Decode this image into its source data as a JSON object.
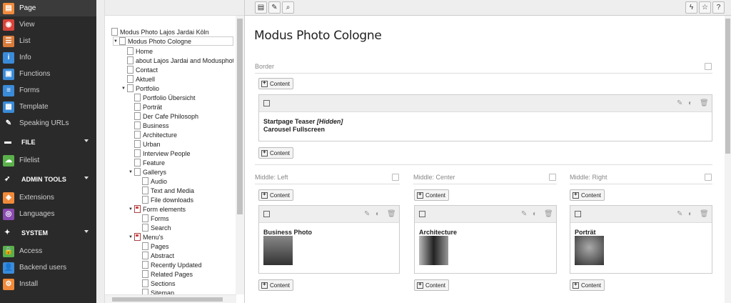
{
  "module_menu": {
    "items": [
      {
        "label": "Page",
        "color": "#f18a3a",
        "glyph": "▤",
        "active": true,
        "icon": "page-icon"
      },
      {
        "label": "View",
        "color": "#d9433a",
        "glyph": "◉",
        "icon": "view-icon"
      },
      {
        "label": "List",
        "color": "#d97b3a",
        "glyph": "☰",
        "icon": "list-icon"
      },
      {
        "label": "Info",
        "color": "#3a8bd9",
        "glyph": "i",
        "icon": "info-icon"
      },
      {
        "label": "Functions",
        "color": "#3a8bd9",
        "glyph": "▣",
        "icon": "functions-icon"
      },
      {
        "label": "Forms",
        "color": "#3a8bd9",
        "glyph": "≡",
        "icon": "forms-icon"
      },
      {
        "label": "Template",
        "color": "#3a8bd9",
        "glyph": "▦",
        "icon": "template-icon"
      },
      {
        "label": "Speaking URLs",
        "color": "#2a2a2a",
        "glyph": "✎",
        "icon": "speaking-urls-icon"
      }
    ],
    "file_section": "FILE",
    "file_items": [
      {
        "label": "Filelist",
        "color": "#5ab04a",
        "glyph": "☁",
        "icon": "filelist-icon"
      }
    ],
    "admin_section": "ADMIN TOOLS",
    "admin_items": [
      {
        "label": "Extensions",
        "color": "#f18a3a",
        "glyph": "◈",
        "icon": "extensions-icon"
      },
      {
        "label": "Languages",
        "color": "#8a4ab0",
        "glyph": "◎",
        "icon": "languages-icon"
      }
    ],
    "system_section": "SYSTEM",
    "system_items": [
      {
        "label": "Access",
        "color": "#5ab04a",
        "glyph": "🔒",
        "icon": "access-icon"
      },
      {
        "label": "Backend users",
        "color": "#3a8bd9",
        "glyph": "👤",
        "icon": "backend-users-icon"
      },
      {
        "label": "Install",
        "color": "#f18a3a",
        "glyph": "⚙",
        "icon": "install-icon"
      }
    ]
  },
  "tree": {
    "root": "Modus Photo Lajos Jardai Köln",
    "site": "Modus Photo Cologne",
    "nodes": [
      "Home",
      "about Lajos Jardai and Modusphoto",
      "Contact",
      "Aktuell",
      "Portfolio",
      "Portfolio Übersicht",
      "Porträt",
      "Der Cafe Philosoph",
      "Business",
      "Architecture",
      "Urban",
      "Interview People",
      "Feature",
      "Gallerys",
      "Audio",
      "Text and Media",
      "File downloads",
      "Form elements",
      "Forms",
      "Search",
      "Menu's",
      "Pages",
      "Abstract",
      "Recently Updated",
      "Related Pages",
      "Sections",
      "Sitemap"
    ]
  },
  "content": {
    "page_title": "Modus Photo Cologne",
    "border_label": "Border",
    "btn_content": "Content",
    "teaser_title": "Startpage Teaser",
    "teaser_hidden": "[Hidden]",
    "teaser_sub": "Carousel Fullscreen",
    "col_left": "Middle: Left",
    "col_center": "Middle: Center",
    "col_right": "Middle: Right",
    "ce_left": "Business Photo",
    "ce_center": "Architecture",
    "ce_right": "Porträt"
  },
  "topbar": {
    "lightning": "ϟ",
    "star": "☆",
    "help": "?"
  }
}
